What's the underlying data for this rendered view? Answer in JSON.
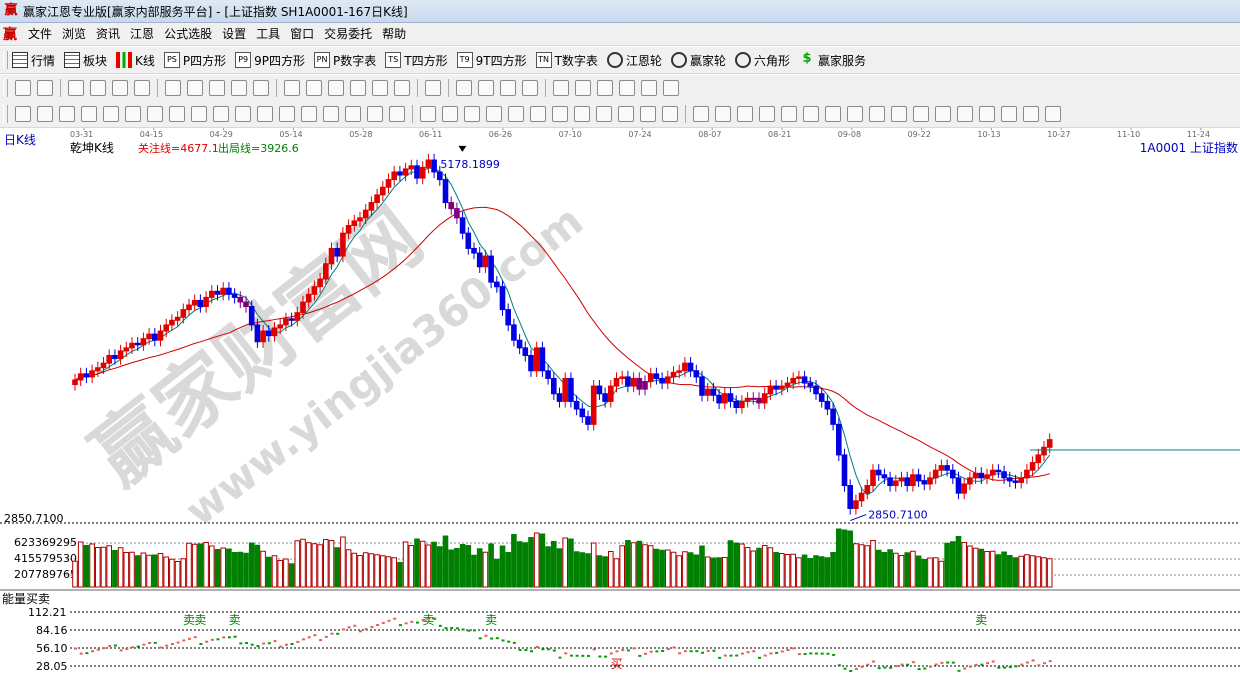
{
  "window": {
    "title": "赢家江恩专业版[赢家内部服务平台] - [上证指数  SH1A0001-167日K线]"
  },
  "menu": [
    "文件",
    "浏览",
    "资讯",
    "江恩",
    "公式选股",
    "设置",
    "工具",
    "窗口",
    "交易委托",
    "帮助"
  ],
  "toolbar1": [
    {
      "label": "行情",
      "icon": "grid-icon",
      "code": ""
    },
    {
      "label": "板块",
      "icon": "blocks-icon",
      "code": ""
    },
    {
      "label": "K线",
      "icon": "candle-icon",
      "code": ""
    },
    {
      "label": "P四方形",
      "icon": "ps-icon",
      "code": "PS"
    },
    {
      "label": "9P四方形",
      "icon": "p9-icon",
      "code": "P9"
    },
    {
      "label": "P数字表",
      "icon": "pn-icon",
      "code": "PN"
    },
    {
      "label": "T四方形",
      "icon": "ts-icon",
      "code": "TS"
    },
    {
      "label": "9T四方形",
      "icon": "t9-icon",
      "code": "T9"
    },
    {
      "label": "T数字表",
      "icon": "tn-icon",
      "code": "TN"
    },
    {
      "label": "江恩轮",
      "icon": "wheel-icon",
      "code": ""
    },
    {
      "label": "赢家轮",
      "icon": "winner-wheel-icon",
      "code": ""
    },
    {
      "label": "六角形",
      "icon": "hexagon-icon",
      "code": ""
    },
    {
      "label": "赢家服务",
      "icon": "dollar-icon",
      "code": ""
    }
  ],
  "chart": {
    "period_label": "日K线",
    "indicator_name": "乾坤K线",
    "focus_line": "关注线=4677.1",
    "exit_line": "出局线=3926.6",
    "code_label": "1A0001  上证指数",
    "dates": [
      "03-31",
      "04-15",
      "04-29",
      "05-14",
      "05-28",
      "06-11",
      "06-26",
      "07-10",
      "07-24",
      "08-07",
      "08-21",
      "09-08",
      "09-22",
      "10-13",
      "10-27",
      "11-10",
      "11-24"
    ],
    "high_label": "5178.1899",
    "low_label": "2850.7100",
    "price_axis_bottom": "2850.7100",
    "volume_axis": [
      "623369295",
      "415579530",
      "207789765"
    ],
    "lower_panel_title": "能量买卖",
    "lower_axis": [
      "112.21",
      "84.16",
      "56.10",
      "28.05"
    ],
    "sell_marks": [
      {
        "text": "卖",
        "day": 20
      },
      {
        "text": "卖",
        "day": 22
      },
      {
        "text": "卖",
        "day": 28
      },
      {
        "text": "卖",
        "day": 62
      },
      {
        "text": "卖",
        "day": 73
      },
      {
        "text": "卖",
        "day": 159
      }
    ],
    "buy_marks": [
      {
        "text": "买",
        "day": 95
      }
    ],
    "watermark_main": "赢家财富网",
    "watermark_sub": "www.yingjia360.com",
    "colors": {
      "up": "#e00000",
      "down": "#0000e0",
      "special": "#800080",
      "vol_up": "#b00000",
      "vol_down": "#008000",
      "ma_short": "#008080",
      "ma_long": "#d00000"
    }
  },
  "chart_data": {
    "type": "candlestick",
    "ylim": [
      2850.71,
      5178.19
    ],
    "closes": [
      3740,
      3780,
      3760,
      3800,
      3820,
      3850,
      3900,
      3880,
      3930,
      3950,
      3980,
      3970,
      4010,
      4040,
      4000,
      4060,
      4100,
      4130,
      4150,
      4200,
      4230,
      4260,
      4220,
      4280,
      4320,
      4300,
      4340,
      4300,
      4280,
      4250,
      4220,
      4100,
      3990,
      4060,
      4030,
      4080,
      4100,
      4140,
      4130,
      4180,
      4250,
      4300,
      4350,
      4400,
      4500,
      4600,
      4550,
      4700,
      4750,
      4780,
      4800,
      4850,
      4900,
      4950,
      5000,
      5050,
      5100,
      5080,
      5120,
      5140,
      5060,
      5130,
      5178,
      5100,
      5050,
      4900,
      4860,
      4800,
      4700,
      4600,
      4570,
      4480,
      4550,
      4380,
      4350,
      4200,
      4100,
      4000,
      3950,
      3900,
      3800,
      3950,
      3800,
      3750,
      3650,
      3600,
      3750,
      3600,
      3550,
      3500,
      3450,
      3700,
      3650,
      3600,
      3700,
      3750,
      3760,
      3700,
      3750,
      3680,
      3730,
      3780,
      3750,
      3720,
      3760,
      3790,
      3800,
      3850,
      3800,
      3760,
      3640,
      3680,
      3640,
      3590,
      3650,
      3600,
      3560,
      3600,
      3620,
      3620,
      3590,
      3650,
      3700,
      3680,
      3700,
      3720,
      3750,
      3760,
      3720,
      3700,
      3650,
      3600,
      3550,
      3450,
      3250,
      3050,
      2900,
      2950,
      3000,
      3050,
      3150,
      3120,
      3100,
      3050,
      3080,
      3100,
      3050,
      3120,
      3080,
      3060,
      3100,
      3150,
      3180,
      3150,
      3100,
      3000,
      3060,
      3100,
      3130,
      3100,
      3120,
      3150,
      3140,
      3100,
      3080,
      3070,
      3100,
      3150,
      3200,
      3250,
      3300,
      3350
    ]
  }
}
